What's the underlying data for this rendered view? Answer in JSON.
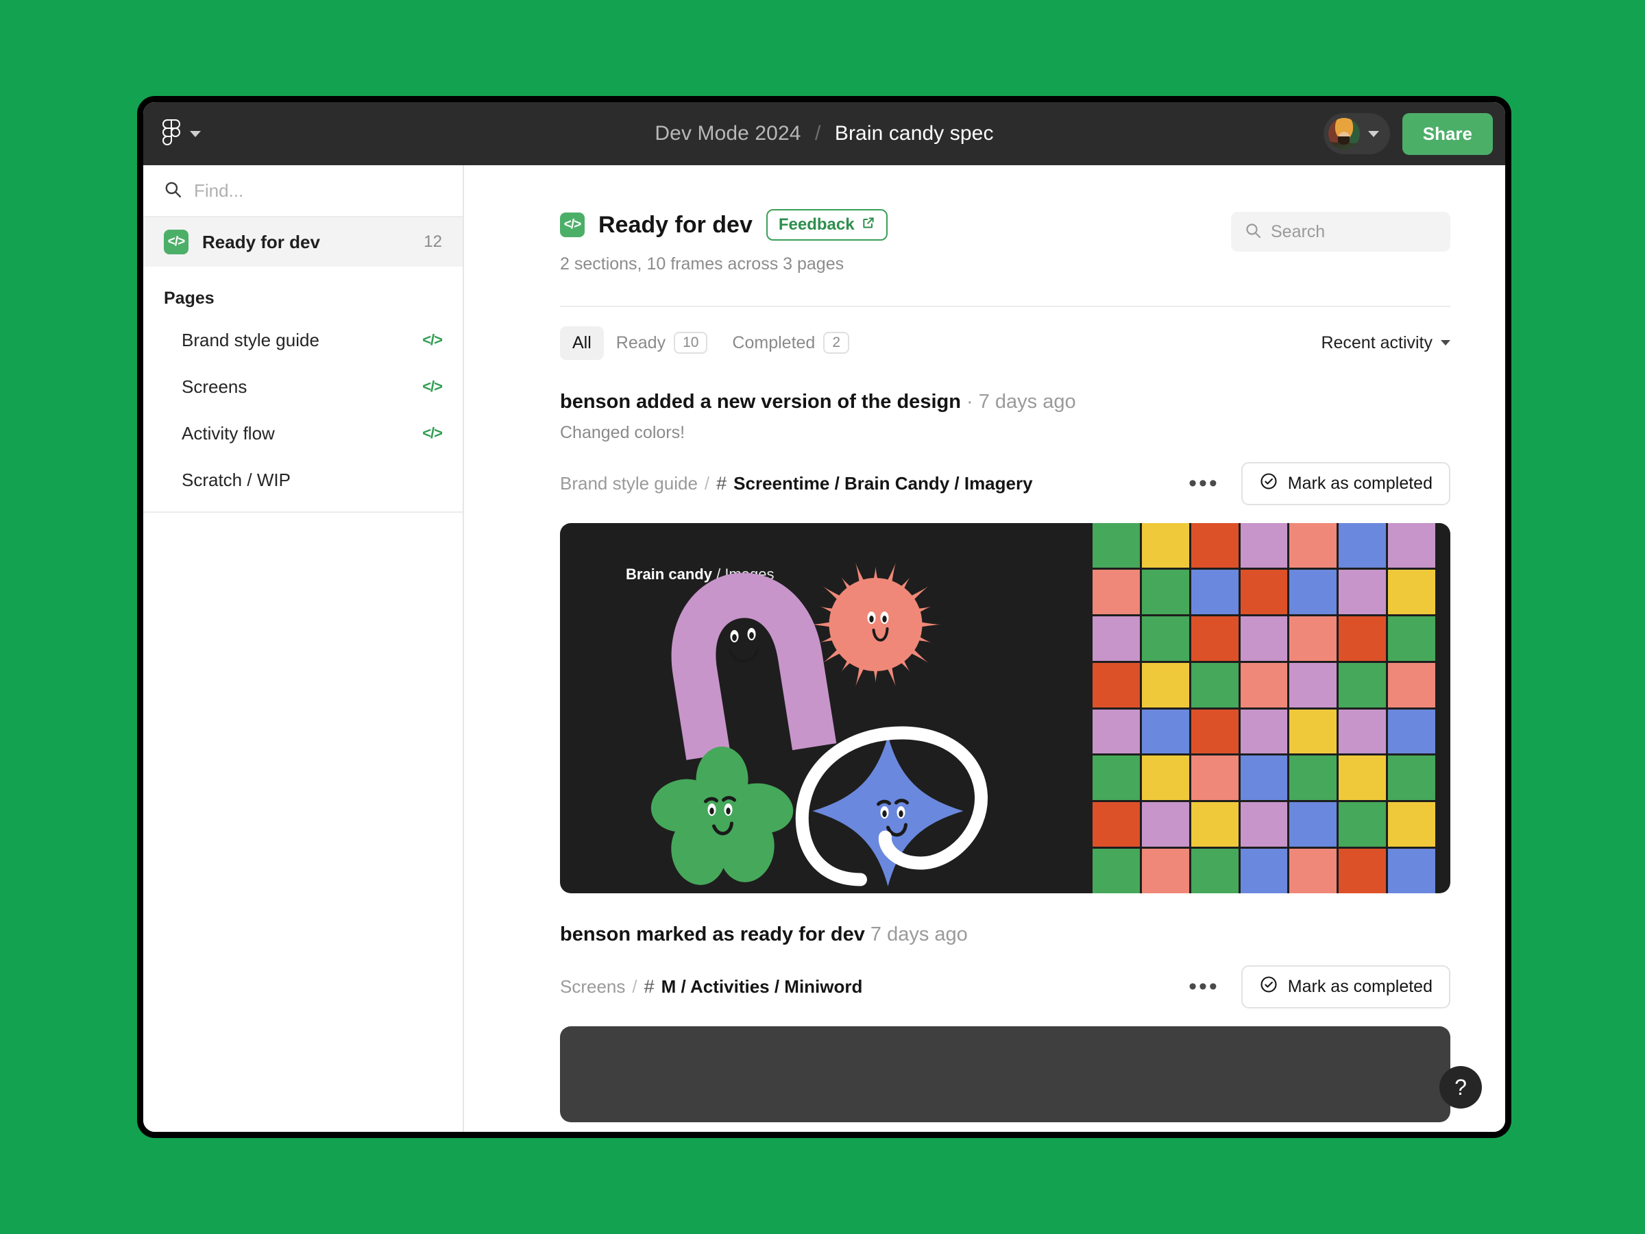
{
  "topbar": {
    "logo_icon": "figma-logo-icon",
    "menu_chevron_icon": "chevron-down-icon",
    "breadcrumb_parent": "Dev Mode 2024",
    "breadcrumb_separator": "/",
    "breadcrumb_current": "Brain candy spec",
    "avatar_name": "avatar",
    "avatar_chevron_icon": "chevron-down-icon",
    "share_label": "Share",
    "share_color": "#4caf68",
    "background_color": "#2c2c2c"
  },
  "sidebar": {
    "find_placeholder": "Find...",
    "find_value": "",
    "search_icon": "search-icon",
    "ready_for_dev": {
      "icon": "code-brackets-icon",
      "label": "Ready for dev",
      "count": "12"
    },
    "pages_heading": "Pages",
    "pages": [
      {
        "label": "Brand style guide",
        "icon": "code-brackets-icon",
        "has_icon": true
      },
      {
        "label": "Screens",
        "icon": "code-brackets-icon",
        "has_icon": true
      },
      {
        "label": "Activity flow",
        "icon": "code-brackets-icon",
        "has_icon": true
      },
      {
        "label": "Scratch / WIP",
        "icon": "",
        "has_icon": false
      }
    ]
  },
  "main": {
    "header": {
      "icon": "code-brackets-icon",
      "title": "Ready for dev",
      "feedback_label": "Feedback",
      "feedback_icon": "external-link-icon",
      "subtitle": "2 sections, 10 frames across 3 pages"
    },
    "search": {
      "placeholder": "Search",
      "value": "",
      "icon": "search-icon"
    },
    "tabs": [
      {
        "label": "All",
        "count": "",
        "active": true
      },
      {
        "label": "Ready",
        "count": "10",
        "active": false
      },
      {
        "label": "Completed",
        "count": "2",
        "active": false
      }
    ],
    "sort": {
      "label": "Recent activity",
      "chevron_icon": "chevron-down-icon"
    },
    "activities": [
      {
        "title": "benson added a new version of the design",
        "title_separator": "·",
        "timestamp": "7 days ago",
        "note": "Changed colors!",
        "path_parent": "Brand style guide",
        "path_separator": "/",
        "frame_icon": "frame-hash-icon",
        "path_current": "Screentime / Brain Candy / Imagery",
        "more_icon": "more-horizontal-icon",
        "mark_complete_label": "Mark as completed",
        "mark_complete_icon": "check-circle-icon",
        "thumbnail": {
          "art_label_bold": "Brain candy",
          "art_label_sep": "/",
          "art_label_light": "Images",
          "background": "#1e1e1e",
          "shapes": [
            {
              "name": "arch-character",
              "color": "#c795ca"
            },
            {
              "name": "starburst-character",
              "color": "#ef8878"
            },
            {
              "name": "flower-character",
              "color": "#46a85a"
            },
            {
              "name": "star-character",
              "color": "#6a88dd"
            },
            {
              "name": "white-loop-squiggle",
              "color": "#ffffff"
            }
          ],
          "swatch_palette": {
            "green": "#46a85a",
            "yellow": "#f0c93a",
            "red": "#dd5129",
            "purple": "#c795ca",
            "salmon": "#ef8878",
            "blue": "#6a88dd"
          },
          "swatch_grid": [
            [
              "green",
              "yellow",
              "red",
              "purple",
              "salmon",
              "blue",
              "purple"
            ],
            [
              "salmon",
              "green",
              "blue",
              "red",
              "blue",
              "purple",
              "yellow"
            ],
            [
              "purple",
              "green",
              "red",
              "purple",
              "salmon",
              "red",
              "green"
            ],
            [
              "red",
              "yellow",
              "green",
              "salmon",
              "purple",
              "green",
              "salmon"
            ],
            [
              "purple",
              "blue",
              "red",
              "purple",
              "yellow",
              "purple",
              "blue"
            ],
            [
              "green",
              "yellow",
              "salmon",
              "blue",
              "green",
              "yellow",
              "green"
            ],
            [
              "red",
              "purple",
              "yellow",
              "purple",
              "blue",
              "green",
              "yellow"
            ],
            [
              "green",
              "salmon",
              "green",
              "blue",
              "salmon",
              "red",
              "blue"
            ]
          ]
        }
      },
      {
        "title": "benson marked as ready for dev",
        "title_separator": "",
        "timestamp": "7 days ago",
        "note": "",
        "path_parent": "Screens",
        "path_separator": "/",
        "frame_icon": "frame-hash-icon",
        "path_current": "M / Activities / Miniword",
        "more_icon": "more-horizontal-icon",
        "mark_complete_label": "Mark as completed",
        "mark_complete_icon": "check-circle-icon",
        "thumbnail": {
          "background": "#3f3f3f"
        }
      }
    ]
  },
  "help": {
    "label": "?",
    "icon": "question-mark-icon"
  },
  "page_background": "#13a350"
}
